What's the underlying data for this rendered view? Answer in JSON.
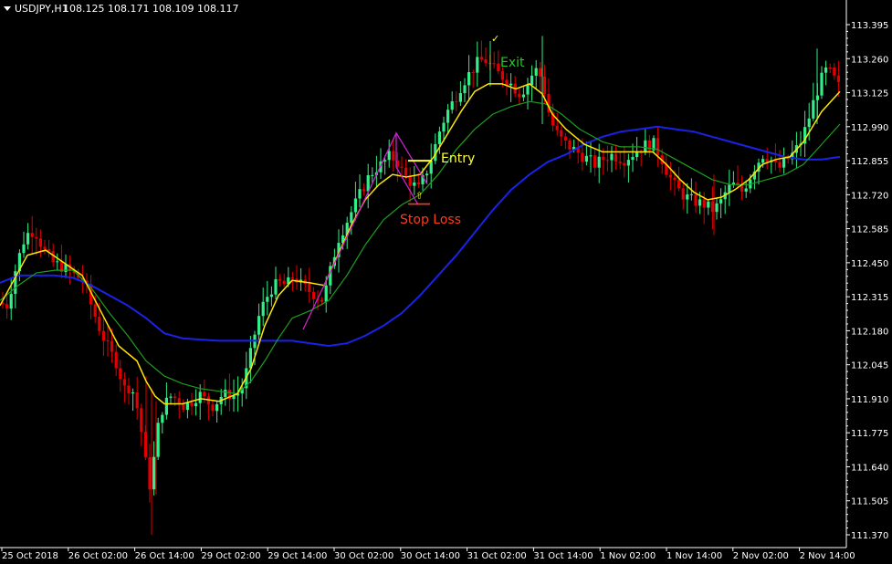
{
  "header": {
    "symbol": "USDJPY,H1",
    "ohlc": "108.125 108.171 108.109 108.117"
  },
  "colors": {
    "background": "#000000",
    "bull": "#33EE88",
    "bear": "#E00000",
    "ma_fast": "#FFE600",
    "ma_mid": "#1E9E1E",
    "ma_slow": "#1A22E8",
    "pattern": "#CC22CC",
    "entry": "#FFFF33",
    "stop": "#FF3B1A",
    "exit": "#22CC22",
    "axis_text": "#FFFFFF"
  },
  "annotations": {
    "entry": "Entry",
    "stop_loss": "Stop Loss",
    "exit": "Exit"
  },
  "chart_data": {
    "type": "candlestick",
    "symbol": "USDJPY",
    "timeframe": "H1",
    "y_ticks": [
      "113.395",
      "113.260",
      "113.125",
      "112.990",
      "112.855",
      "112.720",
      "112.585",
      "112.450",
      "112.315",
      "112.180",
      "112.045",
      "111.910",
      "111.775",
      "111.640",
      "111.505",
      "111.370"
    ],
    "x_ticks": [
      "25 Oct 2018",
      "26 Oct 02:00",
      "26 Oct 14:00",
      "29 Oct 02:00",
      "29 Oct 14:00",
      "30 Oct 02:00",
      "30 Oct 14:00",
      "31 Oct 02:00",
      "31 Oct 14:00",
      "1 Nov 02:00",
      "1 Nov 14:00",
      "2 Nov 02:00",
      "2 Nov 14:00"
    ],
    "ylim": [
      111.33,
      113.45
    ],
    "close_path": [
      [
        0,
        112.29
      ],
      [
        8,
        112.28
      ],
      [
        18,
        112.44
      ],
      [
        28,
        112.56
      ],
      [
        38,
        112.58
      ],
      [
        48,
        112.5
      ],
      [
        58,
        112.45
      ],
      [
        70,
        112.43
      ],
      [
        82,
        112.4
      ],
      [
        92,
        112.38
      ],
      [
        100,
        112.28
      ],
      [
        110,
        112.18
      ],
      [
        120,
        112.1
      ],
      [
        128,
        112.05
      ],
      [
        136,
        111.95
      ],
      [
        144,
        111.96
      ],
      [
        152,
        111.85
      ],
      [
        158,
        111.7
      ],
      [
        163,
        111.55
      ],
      [
        167,
        111.62
      ],
      [
        172,
        111.78
      ],
      [
        178,
        111.87
      ],
      [
        186,
        111.92
      ],
      [
        194,
        111.91
      ],
      [
        202,
        111.88
      ],
      [
        210,
        111.9
      ],
      [
        218,
        111.93
      ],
      [
        226,
        111.9
      ],
      [
        234,
        111.88
      ],
      [
        242,
        111.92
      ],
      [
        250,
        111.93
      ],
      [
        258,
        111.92
      ],
      [
        266,
        111.96
      ],
      [
        274,
        112.08
      ],
      [
        282,
        112.22
      ],
      [
        290,
        112.3
      ],
      [
        298,
        112.35
      ],
      [
        306,
        112.37
      ],
      [
        314,
        112.36
      ],
      [
        322,
        112.4
      ],
      [
        330,
        112.36
      ],
      [
        338,
        112.34
      ],
      [
        346,
        112.32
      ],
      [
        354,
        112.3
      ],
      [
        362,
        112.42
      ],
      [
        370,
        112.54
      ],
      [
        378,
        112.6
      ],
      [
        386,
        112.66
      ],
      [
        394,
        112.72
      ],
      [
        402,
        112.78
      ],
      [
        410,
        112.82
      ],
      [
        418,
        112.84
      ],
      [
        426,
        112.87
      ],
      [
        434,
        112.86
      ],
      [
        442,
        112.8
      ],
      [
        450,
        112.77
      ],
      [
        458,
        112.74
      ],
      [
        466,
        112.8
      ],
      [
        474,
        112.88
      ],
      [
        482,
        112.98
      ],
      [
        490,
        113.05
      ],
      [
        498,
        113.1
      ],
      [
        506,
        113.16
      ],
      [
        514,
        113.2
      ],
      [
        522,
        113.24
      ],
      [
        530,
        113.26
      ],
      [
        538,
        113.23
      ],
      [
        546,
        113.2
      ],
      [
        554,
        113.18
      ],
      [
        562,
        113.15
      ],
      [
        570,
        113.12
      ],
      [
        578,
        113.16
      ],
      [
        586,
        113.22
      ],
      [
        594,
        113.18
      ],
      [
        600,
        113.06
      ],
      [
        606,
        112.99
      ],
      [
        612,
        112.95
      ],
      [
        620,
        112.92
      ],
      [
        628,
        112.9
      ],
      [
        636,
        112.88
      ],
      [
        644,
        112.86
      ],
      [
        652,
        112.84
      ],
      [
        660,
        112.86
      ],
      [
        668,
        112.88
      ],
      [
        676,
        112.87
      ],
      [
        684,
        112.86
      ],
      [
        692,
        112.88
      ],
      [
        700,
        112.9
      ],
      [
        708,
        112.92
      ],
      [
        716,
        112.92
      ],
      [
        724,
        112.87
      ],
      [
        732,
        112.8
      ],
      [
        740,
        112.75
      ],
      [
        748,
        112.72
      ],
      [
        756,
        112.7
      ],
      [
        764,
        112.69
      ],
      [
        772,
        112.68
      ],
      [
        780,
        112.66
      ],
      [
        788,
        112.68
      ],
      [
        796,
        112.74
      ],
      [
        804,
        112.76
      ],
      [
        812,
        112.73
      ],
      [
        820,
        112.78
      ],
      [
        828,
        112.84
      ],
      [
        836,
        112.88
      ],
      [
        844,
        112.86
      ],
      [
        852,
        112.82
      ],
      [
        860,
        112.85
      ],
      [
        868,
        112.88
      ],
      [
        876,
        112.92
      ],
      [
        884,
        113.0
      ],
      [
        892,
        113.1
      ],
      [
        900,
        113.18
      ],
      [
        906,
        113.22
      ],
      [
        912,
        113.19
      ],
      [
        918,
        113.15
      ]
    ],
    "series": [
      {
        "name": "MA fast",
        "values": [
          [
            0,
            112.28
          ],
          [
            15,
            112.38
          ],
          [
            30,
            112.48
          ],
          [
            50,
            112.5
          ],
          [
            70,
            112.45
          ],
          [
            90,
            112.4
          ],
          [
            110,
            112.26
          ],
          [
            130,
            112.12
          ],
          [
            150,
            112.06
          ],
          [
            160,
            111.98
          ],
          [
            170,
            111.92
          ],
          [
            180,
            111.89
          ],
          [
            200,
            111.89
          ],
          [
            220,
            111.91
          ],
          [
            240,
            111.9
          ],
          [
            260,
            111.93
          ],
          [
            275,
            112.03
          ],
          [
            290,
            112.2
          ],
          [
            305,
            112.32
          ],
          [
            320,
            112.38
          ],
          [
            340,
            112.37
          ],
          [
            355,
            112.36
          ],
          [
            370,
            112.48
          ],
          [
            385,
            112.6
          ],
          [
            400,
            112.7
          ],
          [
            415,
            112.76
          ],
          [
            430,
            112.8
          ],
          [
            445,
            112.79
          ],
          [
            460,
            112.8
          ],
          [
            475,
            112.87
          ],
          [
            490,
            112.96
          ],
          [
            505,
            113.05
          ],
          [
            520,
            113.13
          ],
          [
            535,
            113.16
          ],
          [
            550,
            113.16
          ],
          [
            565,
            113.14
          ],
          [
            580,
            113.16
          ],
          [
            594,
            113.12
          ],
          [
            605,
            113.04
          ],
          [
            620,
            112.98
          ],
          [
            640,
            112.92
          ],
          [
            660,
            112.89
          ],
          [
            680,
            112.89
          ],
          [
            700,
            112.89
          ],
          [
            715,
            112.89
          ],
          [
            730,
            112.84
          ],
          [
            745,
            112.78
          ],
          [
            760,
            112.73
          ],
          [
            775,
            112.7
          ],
          [
            790,
            112.71
          ],
          [
            805,
            112.74
          ],
          [
            820,
            112.78
          ],
          [
            835,
            112.84
          ],
          [
            850,
            112.86
          ],
          [
            865,
            112.87
          ],
          [
            880,
            112.93
          ],
          [
            900,
            113.05
          ],
          [
            920,
            113.13
          ]
        ]
      },
      {
        "name": "MA mid",
        "values": [
          [
            0,
            112.3
          ],
          [
            20,
            112.36
          ],
          [
            40,
            112.41
          ],
          [
            60,
            112.42
          ],
          [
            80,
            112.42
          ],
          [
            100,
            112.35
          ],
          [
            120,
            112.25
          ],
          [
            140,
            112.16
          ],
          [
            160,
            112.06
          ],
          [
            180,
            112.0
          ],
          [
            200,
            111.97
          ],
          [
            220,
            111.95
          ],
          [
            240,
            111.94
          ],
          [
            260,
            111.93
          ],
          [
            275,
            111.98
          ],
          [
            290,
            112.06
          ],
          [
            305,
            112.15
          ],
          [
            320,
            112.23
          ],
          [
            340,
            112.26
          ],
          [
            360,
            112.3
          ],
          [
            380,
            112.4
          ],
          [
            400,
            112.52
          ],
          [
            420,
            112.62
          ],
          [
            440,
            112.68
          ],
          [
            460,
            112.72
          ],
          [
            480,
            112.8
          ],
          [
            500,
            112.9
          ],
          [
            520,
            112.98
          ],
          [
            540,
            113.04
          ],
          [
            560,
            113.07
          ],
          [
            580,
            113.09
          ],
          [
            598,
            113.08
          ],
          [
            615,
            113.04
          ],
          [
            635,
            112.98
          ],
          [
            660,
            112.93
          ],
          [
            680,
            112.91
          ],
          [
            700,
            112.91
          ],
          [
            720,
            112.9
          ],
          [
            740,
            112.86
          ],
          [
            760,
            112.82
          ],
          [
            780,
            112.78
          ],
          [
            800,
            112.76
          ],
          [
            820,
            112.76
          ],
          [
            840,
            112.78
          ],
          [
            860,
            112.8
          ],
          [
            880,
            112.84
          ],
          [
            900,
            112.92
          ],
          [
            920,
            113.0
          ]
        ]
      },
      {
        "name": "MA slow",
        "values": [
          [
            0,
            112.37
          ],
          [
            20,
            112.4
          ],
          [
            40,
            112.4
          ],
          [
            60,
            112.4
          ],
          [
            80,
            112.39
          ],
          [
            100,
            112.36
          ],
          [
            120,
            112.32
          ],
          [
            140,
            112.28
          ],
          [
            160,
            112.23
          ],
          [
            180,
            112.17
          ],
          [
            200,
            112.15
          ],
          [
            220,
            112.145
          ],
          [
            240,
            112.14
          ],
          [
            260,
            112.14
          ],
          [
            280,
            112.14
          ],
          [
            300,
            112.14
          ],
          [
            320,
            112.14
          ],
          [
            340,
            112.13
          ],
          [
            360,
            112.12
          ],
          [
            380,
            112.13
          ],
          [
            400,
            112.16
          ],
          [
            420,
            112.2
          ],
          [
            440,
            112.25
          ],
          [
            460,
            112.32
          ],
          [
            480,
            112.4
          ],
          [
            500,
            112.48
          ],
          [
            520,
            112.57
          ],
          [
            540,
            112.66
          ],
          [
            560,
            112.74
          ],
          [
            580,
            112.8
          ],
          [
            600,
            112.85
          ],
          [
            620,
            112.88
          ],
          [
            640,
            112.92
          ],
          [
            660,
            112.95
          ],
          [
            680,
            112.97
          ],
          [
            700,
            112.98
          ],
          [
            720,
            112.99
          ],
          [
            740,
            112.98
          ],
          [
            760,
            112.97
          ],
          [
            780,
            112.95
          ],
          [
            800,
            112.93
          ],
          [
            820,
            112.91
          ],
          [
            840,
            112.89
          ],
          [
            860,
            112.87
          ],
          [
            880,
            112.86
          ],
          [
            900,
            112.86
          ],
          [
            920,
            112.87
          ]
        ]
      }
    ],
    "entry_price": 112.855,
    "stop_loss_price": 112.683,
    "exit_price": 113.21
  }
}
